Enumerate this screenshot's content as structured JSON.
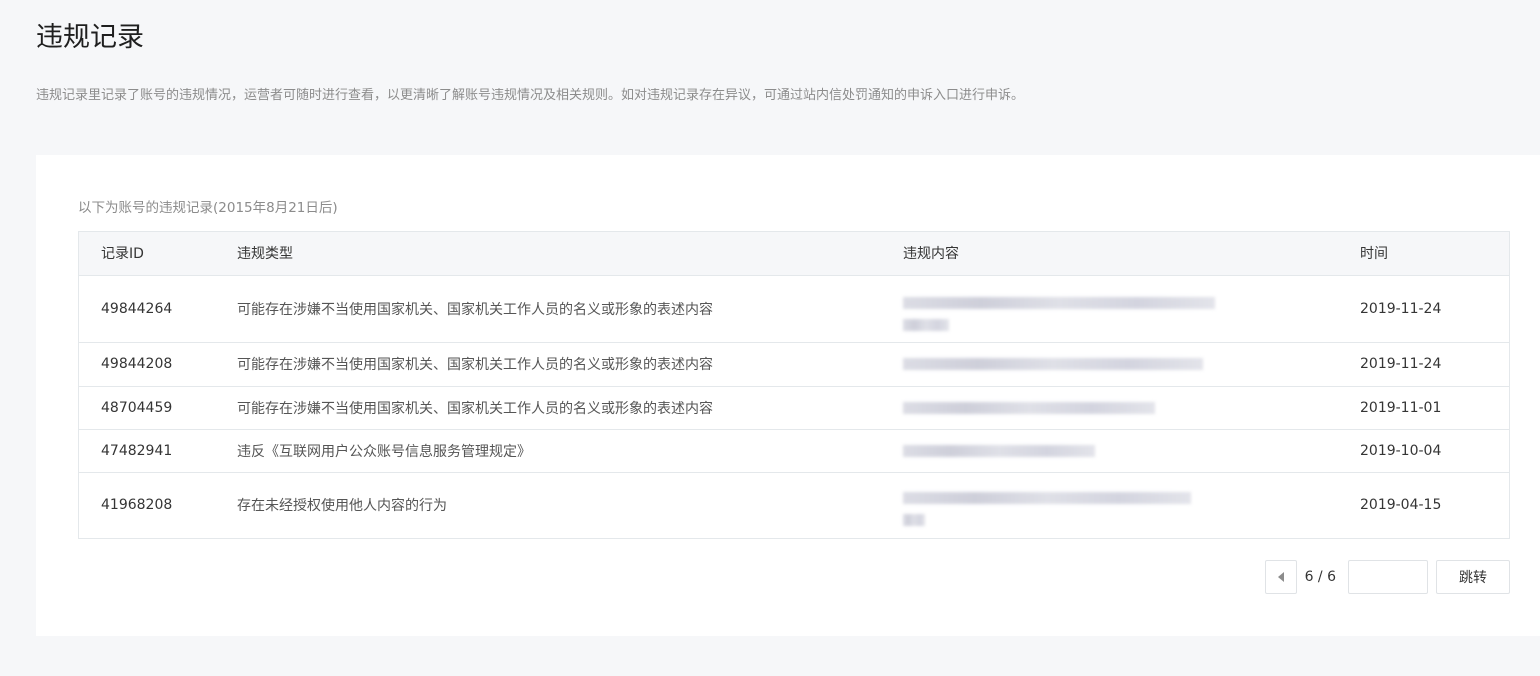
{
  "page": {
    "title": "违规记录",
    "description": "违规记录里记录了账号的违规情况，运营者可随时进行查看，以更清晰了解账号违规情况及相关规则。如对违规记录存在异议，可通过站内信处罚通知的申诉入口进行申诉。"
  },
  "card": {
    "subtitle": "以下为账号的违规记录(2015年8月21日后)"
  },
  "table": {
    "headers": {
      "id": "记录ID",
      "type": "违规类型",
      "content": "违规内容",
      "time": "时间"
    },
    "rows": [
      {
        "id": "49844264",
        "type": "可能存在涉嫌不当使用国家机关、国家机关工作人员的名义或形象的表述内容",
        "time": "2019-11-24"
      },
      {
        "id": "49844208",
        "type": "可能存在涉嫌不当使用国家机关、国家机关工作人员的名义或形象的表述内容",
        "time": "2019-11-24"
      },
      {
        "id": "48704459",
        "type": "可能存在涉嫌不当使用国家机关、国家机关工作人员的名义或形象的表述内容",
        "time": "2019-11-01"
      },
      {
        "id": "47482941",
        "type": "违反《互联网用户公众账号信息服务管理规定》",
        "time": "2019-10-04"
      },
      {
        "id": "41968208",
        "type": "存在未经授权使用他人内容的行为",
        "time": "2019-04-15"
      }
    ]
  },
  "pagination": {
    "page_text": "6 / 6",
    "input_value": "",
    "jump_label": "跳转"
  }
}
